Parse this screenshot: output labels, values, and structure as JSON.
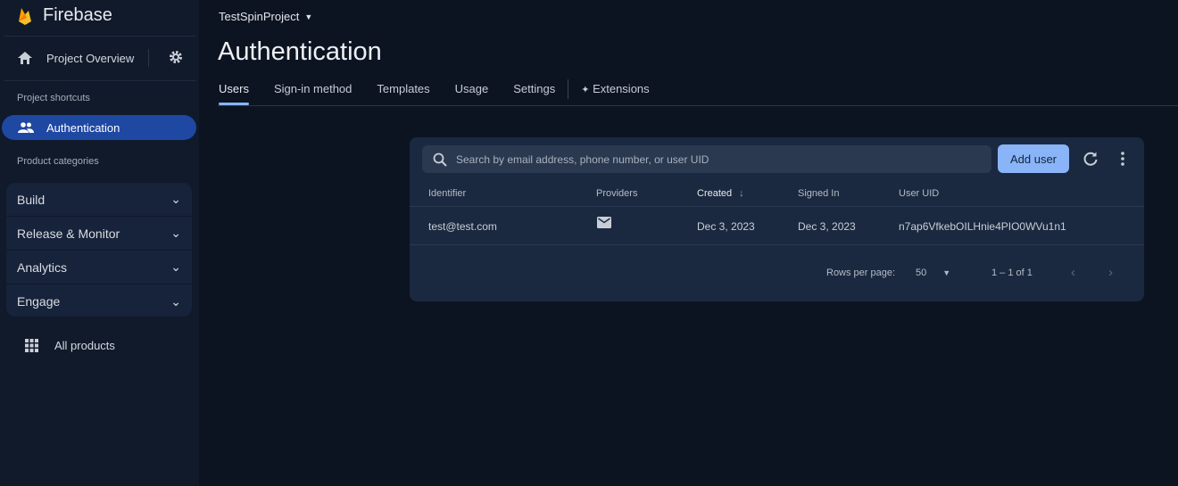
{
  "brand": "Firebase",
  "sidebar": {
    "project_overview": "Project Overview",
    "shortcuts_label": "Project shortcuts",
    "active_item": "Authentication",
    "categories_label": "Product categories",
    "categories": [
      {
        "label": "Build"
      },
      {
        "label": "Release & Monitor"
      },
      {
        "label": "Analytics"
      },
      {
        "label": "Engage"
      }
    ],
    "all_products": "All products"
  },
  "header": {
    "project": "TestSpinProject",
    "title": "Authentication",
    "tabs": [
      {
        "label": "Users"
      },
      {
        "label": "Sign-in method"
      },
      {
        "label": "Templates"
      },
      {
        "label": "Usage"
      },
      {
        "label": "Settings"
      },
      {
        "label": "Extensions"
      }
    ]
  },
  "users": {
    "search_placeholder": "Search by email address, phone number, or user UID",
    "add_user": "Add user",
    "columns": [
      "Identifier",
      "Providers",
      "Created",
      "Signed In",
      "User UID"
    ],
    "rows": [
      {
        "identifier": "test@test.com",
        "provider": "email-icon",
        "created": "Dec 3, 2023",
        "signed_in": "Dec 3, 2023",
        "uid": "n7ap6VfkebOILHnie4PIO0WVu1n1"
      }
    ],
    "rows_per_page_label": "Rows per page:",
    "rows_per_page": "50",
    "range": "1 – 1 of 1"
  },
  "colors": {
    "accent": "#8ab4f8",
    "active_nav": "#1f48a3"
  }
}
